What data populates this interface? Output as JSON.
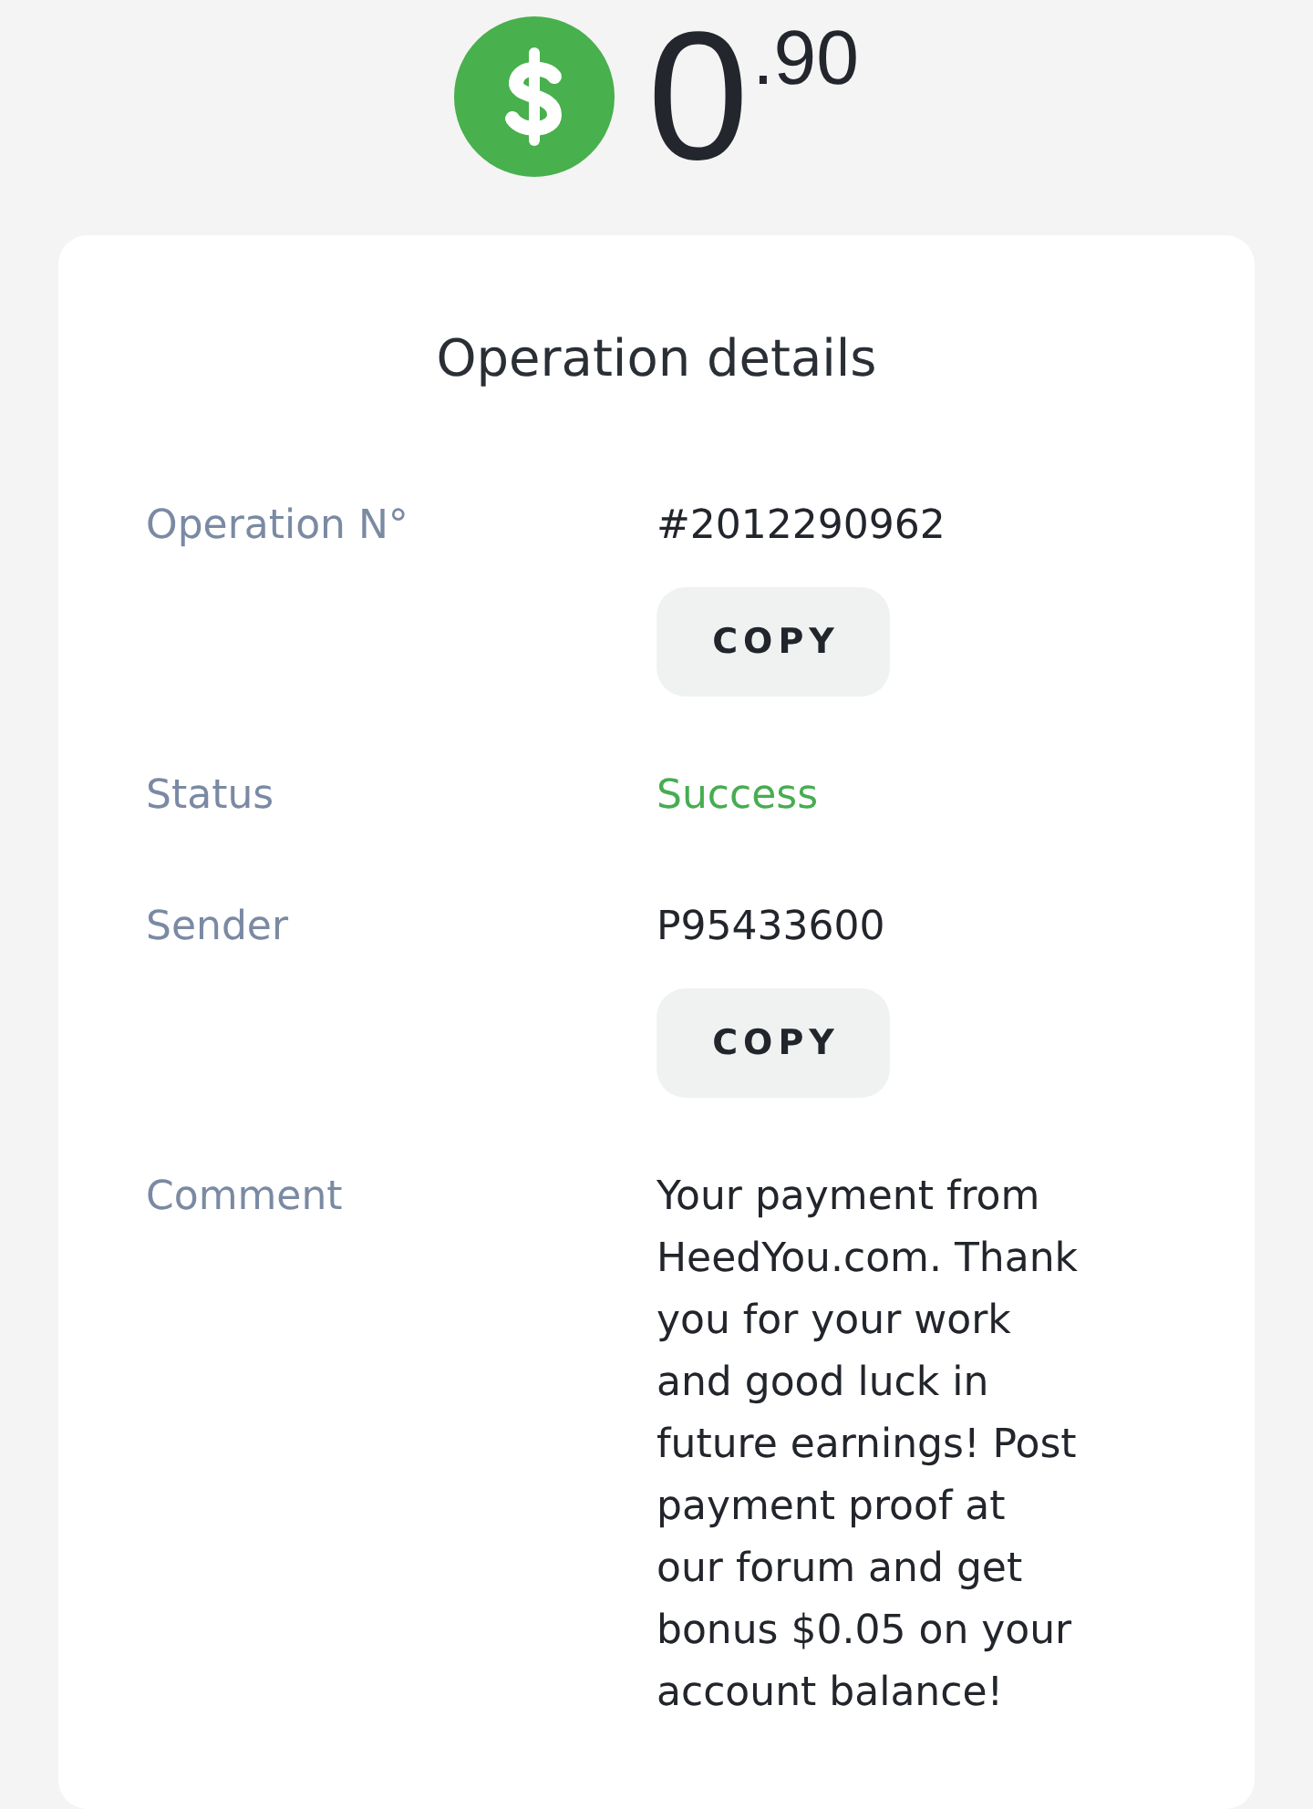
{
  "balance": {
    "integer": "0",
    "fraction": ".90"
  },
  "card": {
    "title": "Operation details",
    "rows": [
      {
        "kind": "copyable",
        "label": "Operation N°",
        "value": "#2012290962",
        "button": "COPY"
      },
      {
        "kind": "status",
        "label": "Status",
        "value": "Success"
      },
      {
        "kind": "copyable",
        "label": "Sender",
        "value": "P95433600",
        "button": "COPY"
      },
      {
        "kind": "text",
        "label": "Comment",
        "value": "Your payment from HeedYou.com. Thank you for your work and good luck in future earnings! Post payment proof at our forum and get bonus $0.05 on your account balance!"
      }
    ]
  }
}
